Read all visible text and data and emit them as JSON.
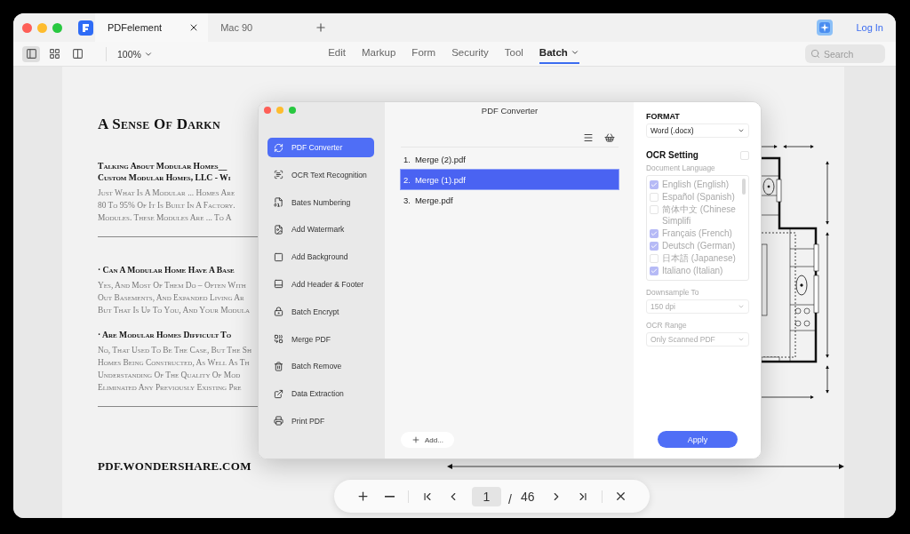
{
  "window": {
    "tabs": [
      {
        "label": "PDFelement",
        "selected": true,
        "closable": true
      },
      {
        "label": "Mac 90",
        "selected": false,
        "closable": false
      }
    ],
    "login": "Log In"
  },
  "toolbar": {
    "views": [
      {
        "selected": true
      },
      {
        "selected": false
      },
      {
        "selected": false
      }
    ],
    "zoom": "100%",
    "menu": [
      {
        "label": "Edit",
        "selected": false
      },
      {
        "label": "Markup",
        "selected": false
      },
      {
        "label": "Form",
        "selected": false
      },
      {
        "label": "Security",
        "selected": false
      },
      {
        "label": "Tool",
        "selected": false
      },
      {
        "label": "Batch",
        "selected": true
      }
    ],
    "search": {
      "placeholder": "Search"
    }
  },
  "document": {
    "title": "A Sense Of Darkn",
    "blocks": [
      {
        "kind": "heading",
        "lines": [
          "Talking About Modular Homes__",
          "Custom Modular Homes, LLC - Wi"
        ]
      },
      {
        "kind": "body",
        "lines": [
          "Just What Is A Modular ... Homes Are",
          "80 To 95% Of It Is Built In A Factory.",
          "Modules. These Modules Are ... To A"
        ]
      },
      {
        "kind": "rule"
      },
      {
        "kind": "heading",
        "lines": [
          "· Can A Modular Home Have A Base"
        ]
      },
      {
        "kind": "body",
        "lines": [
          "Yes, And Most Of Them Do – Often With",
          "Out Basements, And Expanded Living Ar",
          "But That Is Up To You, And Your Modula"
        ]
      },
      {
        "kind": "heading",
        "lines": [
          "· Are Modular Homes Difficult To"
        ]
      },
      {
        "kind": "body",
        "lines": [
          "No, That Used To Be The Case, But The Sh",
          "Homes Being Constructed, As Well As Th",
          "Understanding Of The Quality Of Mod",
          "Eliminated Any Previously Existing Pre"
        ]
      },
      {
        "kind": "rule"
      }
    ],
    "footer": "PDF.WONDERSHARE.COM"
  },
  "dialog": {
    "title": "PDF Converter",
    "tools": [
      {
        "label": "PDF Converter",
        "selected": true
      },
      {
        "label": "OCR Text Recognition",
        "selected": false
      },
      {
        "label": "Bates Numbering",
        "selected": false
      },
      {
        "label": "Add Watermark",
        "selected": false
      },
      {
        "label": "Add Background",
        "selected": false
      },
      {
        "label": "Add Header & Footer",
        "selected": false
      },
      {
        "label": "Batch Encrypt",
        "selected": false
      },
      {
        "label": "Merge PDF",
        "selected": false
      },
      {
        "label": "Batch Remove",
        "selected": false
      },
      {
        "label": "Data Extraction",
        "selected": false
      },
      {
        "label": "Print PDF",
        "selected": false
      }
    ],
    "files": [
      {
        "number": "1.",
        "name": "Merge (2).pdf",
        "selected": false
      },
      {
        "number": "2.",
        "name": "Merge (1).pdf",
        "selected": true
      },
      {
        "number": "3.",
        "name": "Merge.pdf",
        "selected": false
      }
    ],
    "add_button": "Add...",
    "settings": {
      "format": {
        "label": "FORMAT",
        "value": "Word (.docx)"
      },
      "ocr": {
        "label": "OCR Setting",
        "checked": false
      },
      "languages": {
        "label": "Document Language",
        "disabled": true,
        "items": [
          {
            "label": "English (English)",
            "checked": true
          },
          {
            "label": "Español (Spanish)",
            "checked": false
          },
          {
            "label": "简体中文 (Chinese Simplifi",
            "checked": false
          },
          {
            "label": "Français (French)",
            "checked": true
          },
          {
            "label": "Deutsch (German)",
            "checked": true
          },
          {
            "label": "日本語 (Japanese)",
            "checked": false
          },
          {
            "label": "Italiano (Italian)",
            "checked": true
          }
        ]
      },
      "downsample": {
        "label": "Downsample To",
        "value": "150 dpi",
        "disabled": true
      },
      "range": {
        "label": "OCR Range",
        "value": "Only Scanned PDF",
        "disabled": true
      },
      "apply": "Apply"
    }
  },
  "pager": {
    "page": "1",
    "separator": "/",
    "total": "46"
  }
}
